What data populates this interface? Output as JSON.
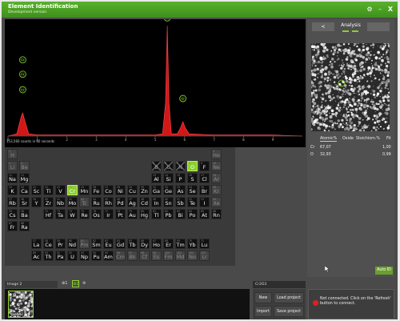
{
  "window": {
    "title": "Element Identification",
    "subtitle": "Development version",
    "buttons": {
      "settings": "⚙",
      "minimize": "–",
      "close": "X"
    }
  },
  "spectrum": {
    "counts_text": "153,560 counts in 60 seconds",
    "x_tick_labels": [
      "0",
      "1",
      "2",
      "3",
      "4",
      "5",
      "6",
      "7",
      "8",
      "9"
    ],
    "peak_labels": [
      "Cr",
      "Cr",
      "Cr",
      "Cr",
      "Cr"
    ],
    "peak_color": "#d01818"
  },
  "chart_data": {
    "type": "line",
    "title": "",
    "xlabel": "",
    "ylabel": "",
    "xlim": [
      0,
      10
    ],
    "x": [
      0.0,
      0.3,
      0.45,
      0.5,
      0.55,
      0.7,
      1.0,
      2.0,
      3.0,
      4.0,
      5.0,
      5.25,
      5.35,
      5.41,
      5.47,
      5.55,
      5.75,
      5.85,
      5.94,
      6.03,
      6.15,
      7.0,
      8.0,
      9.0,
      10.0
    ],
    "series": [
      {
        "values": [
          0,
          0.02,
          0.18,
          0.21,
          0.16,
          0.02,
          0.01,
          0.01,
          0.01,
          0.01,
          0.01,
          0.02,
          0.3,
          1.0,
          0.3,
          0.02,
          0.02,
          0.07,
          0.13,
          0.07,
          0.02,
          0.01,
          0.01,
          0.01,
          0.0
        ]
      }
    ]
  },
  "periodic_table": {
    "elements": [
      [
        "H",
        1,
        0,
        1,
        "dim"
      ],
      [
        "He",
        2,
        17,
        1,
        "dim"
      ],
      [
        "Li",
        3,
        0,
        2,
        "dim"
      ],
      [
        "Be",
        4,
        1,
        2,
        "dim"
      ],
      [
        "B",
        5,
        12,
        2,
        "excl"
      ],
      [
        "C",
        6,
        13,
        2,
        "excl"
      ],
      [
        "N",
        7,
        14,
        2,
        "excl"
      ],
      [
        "O",
        8,
        15,
        2,
        "hl"
      ],
      [
        "F",
        9,
        16,
        2,
        ""
      ],
      [
        "Ne",
        10,
        17,
        2,
        "dim"
      ],
      [
        "Na",
        11,
        0,
        3,
        ""
      ],
      [
        "Mg",
        12,
        1,
        3,
        ""
      ],
      [
        "Al",
        13,
        12,
        3,
        ""
      ],
      [
        "Si",
        14,
        13,
        3,
        ""
      ],
      [
        "P",
        15,
        14,
        3,
        ""
      ],
      [
        "S",
        16,
        15,
        3,
        ""
      ],
      [
        "Cl",
        17,
        16,
        3,
        ""
      ],
      [
        "Ar",
        18,
        17,
        3,
        "dim"
      ],
      [
        "K",
        19,
        0,
        4,
        ""
      ],
      [
        "Ca",
        20,
        1,
        4,
        ""
      ],
      [
        "Sc",
        21,
        2,
        4,
        ""
      ],
      [
        "Ti",
        22,
        3,
        4,
        ""
      ],
      [
        "V",
        23,
        4,
        4,
        ""
      ],
      [
        "Cr",
        24,
        5,
        4,
        "hl"
      ],
      [
        "Mn",
        25,
        6,
        4,
        ""
      ],
      [
        "Fe",
        26,
        7,
        4,
        ""
      ],
      [
        "Co",
        27,
        8,
        4,
        ""
      ],
      [
        "Ni",
        28,
        9,
        4,
        ""
      ],
      [
        "Cu",
        29,
        10,
        4,
        ""
      ],
      [
        "Zn",
        30,
        11,
        4,
        ""
      ],
      [
        "Ga",
        31,
        12,
        4,
        ""
      ],
      [
        "Ge",
        32,
        13,
        4,
        ""
      ],
      [
        "As",
        33,
        14,
        4,
        ""
      ],
      [
        "Se",
        34,
        15,
        4,
        ""
      ],
      [
        "Br",
        35,
        16,
        4,
        ""
      ],
      [
        "Kr",
        36,
        17,
        4,
        "dim"
      ],
      [
        "Rb",
        37,
        0,
        5,
        ""
      ],
      [
        "Sr",
        38,
        1,
        5,
        ""
      ],
      [
        "Y",
        39,
        2,
        5,
        ""
      ],
      [
        "Zr",
        40,
        3,
        5,
        ""
      ],
      [
        "Nb",
        41,
        4,
        5,
        ""
      ],
      [
        "Mo",
        42,
        5,
        5,
        ""
      ],
      [
        "Tc",
        43,
        6,
        5,
        "dim"
      ],
      [
        "Ru",
        44,
        7,
        5,
        ""
      ],
      [
        "Rh",
        45,
        8,
        5,
        ""
      ],
      [
        "Pd",
        46,
        9,
        5,
        ""
      ],
      [
        "Ag",
        47,
        10,
        5,
        ""
      ],
      [
        "Cd",
        48,
        11,
        5,
        ""
      ],
      [
        "In",
        49,
        12,
        5,
        ""
      ],
      [
        "Sn",
        50,
        13,
        5,
        ""
      ],
      [
        "Sb",
        51,
        14,
        5,
        ""
      ],
      [
        "Te",
        52,
        15,
        5,
        ""
      ],
      [
        "I",
        53,
        16,
        5,
        ""
      ],
      [
        "Xe",
        54,
        17,
        5,
        "dim"
      ],
      [
        "Cs",
        55,
        0,
        6,
        ""
      ],
      [
        "Ba",
        56,
        1,
        6,
        ""
      ],
      [
        "Hf",
        72,
        3,
        6,
        ""
      ],
      [
        "Ta",
        73,
        4,
        6,
        ""
      ],
      [
        "W",
        74,
        5,
        6,
        ""
      ],
      [
        "Re",
        75,
        6,
        6,
        ""
      ],
      [
        "Os",
        76,
        7,
        6,
        ""
      ],
      [
        "Ir",
        77,
        8,
        6,
        ""
      ],
      [
        "Pt",
        78,
        9,
        6,
        ""
      ],
      [
        "Au",
        79,
        10,
        6,
        ""
      ],
      [
        "Hg",
        80,
        11,
        6,
        ""
      ],
      [
        "Tl",
        81,
        12,
        6,
        ""
      ],
      [
        "Pb",
        82,
        13,
        6,
        ""
      ],
      [
        "Bi",
        83,
        14,
        6,
        ""
      ],
      [
        "Po",
        84,
        15,
        6,
        ""
      ],
      [
        "At",
        85,
        16,
        6,
        ""
      ],
      [
        "Rn",
        86,
        17,
        6,
        ""
      ],
      [
        "Fr",
        87,
        0,
        7,
        ""
      ],
      [
        "Ra",
        88,
        1,
        7,
        ""
      ],
      [
        "La",
        57,
        2,
        9,
        ""
      ],
      [
        "Ce",
        58,
        3,
        9,
        ""
      ],
      [
        "Pr",
        59,
        4,
        9,
        ""
      ],
      [
        "Nd",
        60,
        5,
        9,
        ""
      ],
      [
        "Pm",
        61,
        6,
        9,
        "dim"
      ],
      [
        "Sm",
        62,
        7,
        9,
        ""
      ],
      [
        "Eu",
        63,
        8,
        9,
        ""
      ],
      [
        "Gd",
        64,
        9,
        9,
        ""
      ],
      [
        "Tb",
        65,
        10,
        9,
        ""
      ],
      [
        "Dy",
        66,
        11,
        9,
        ""
      ],
      [
        "Ho",
        67,
        12,
        9,
        ""
      ],
      [
        "Er",
        68,
        13,
        9,
        ""
      ],
      [
        "Tm",
        69,
        14,
        9,
        ""
      ],
      [
        "Yb",
        70,
        15,
        9,
        ""
      ],
      [
        "Lu",
        71,
        16,
        9,
        ""
      ],
      [
        "Ac",
        89,
        2,
        10,
        ""
      ],
      [
        "Th",
        90,
        3,
        10,
        ""
      ],
      [
        "Pa",
        91,
        4,
        10,
        ""
      ],
      [
        "U",
        92,
        5,
        10,
        ""
      ],
      [
        "Np",
        93,
        6,
        10,
        ""
      ],
      [
        "Pu",
        94,
        7,
        10,
        ""
      ],
      [
        "Am",
        95,
        8,
        10,
        ""
      ],
      [
        "Cm",
        96,
        9,
        10,
        "dim"
      ],
      [
        "Bk",
        97,
        10,
        10,
        "dim"
      ],
      [
        "Cf",
        98,
        11,
        10,
        "dim"
      ],
      [
        "Es",
        99,
        12,
        10,
        "dim"
      ],
      [
        "Fm",
        100,
        13,
        10,
        "dim"
      ],
      [
        "Md",
        101,
        14,
        10,
        "dim"
      ],
      [
        "No",
        102,
        15,
        10,
        "dim"
      ],
      [
        "Lr",
        103,
        16,
        10,
        "dim"
      ]
    ]
  },
  "analysis": {
    "prev_label": "<",
    "title": "Analysis",
    "headers": {
      "atomic": "Atomic%",
      "oxide": "Oxide",
      "stoichiom": "Stoichiom.%",
      "fit": "Fit"
    },
    "rows": [
      {
        "element": "Cr",
        "atomic": "67,07",
        "fit": "1,00"
      },
      {
        "element": "O",
        "atomic": "32,93",
        "fit": "0,99"
      }
    ],
    "auto_id": "Auto ID"
  },
  "bottom": {
    "image_tab": "Image 2",
    "tool_a": "⊕1",
    "tool_b": "⊕2",
    "tool_c": "✣",
    "thumb_label": "Image 2",
    "project_name": "Cr2O3",
    "new": "New",
    "load": "Load project",
    "import": "Import",
    "save": "Save project",
    "status": "Not connected. Click on the 'Refresh' button to connect."
  }
}
